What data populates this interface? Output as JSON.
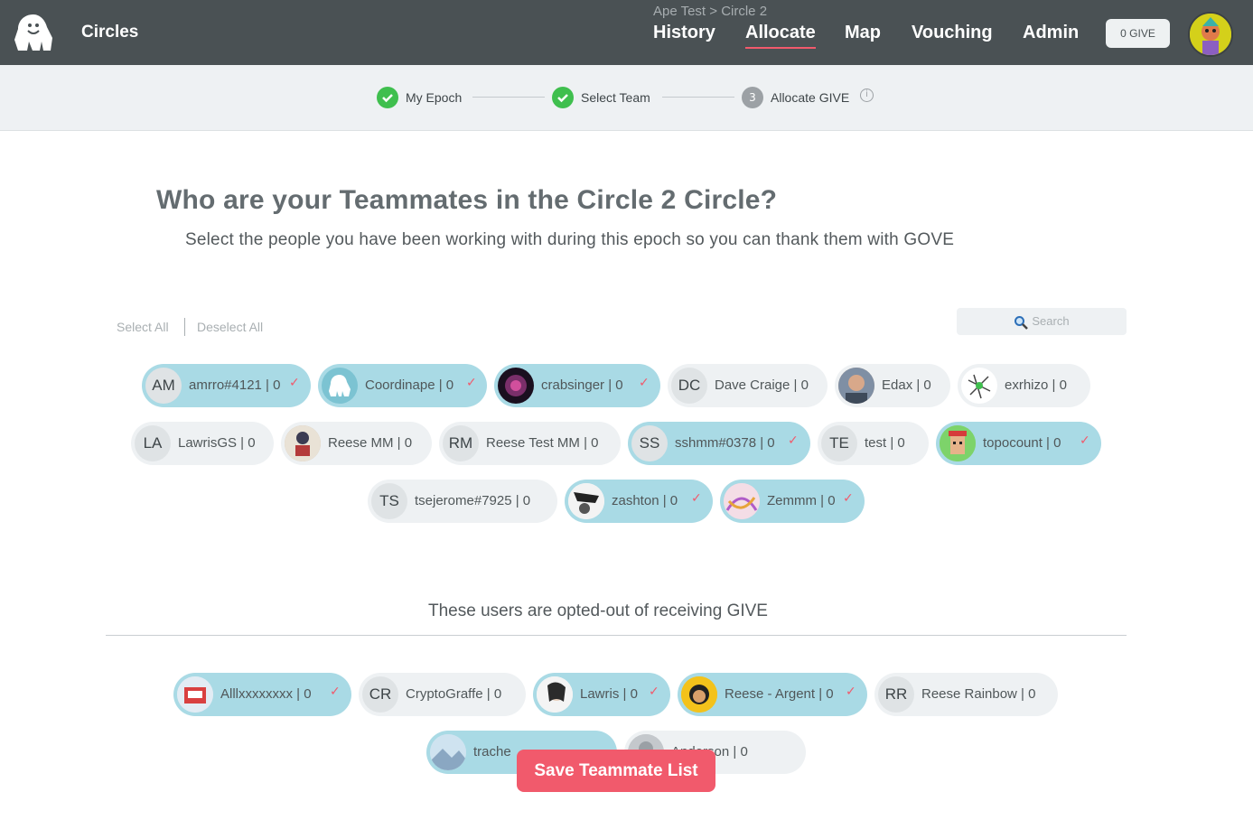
{
  "header": {
    "brand": "Circles",
    "breadcrumb": "Ape Test > Circle 2",
    "nav": [
      "History",
      "Allocate",
      "Map",
      "Vouching",
      "Admin"
    ],
    "active_nav": "Allocate",
    "give_button": "0 GIVE",
    "avatar_icon": "profile-avatar"
  },
  "steps": [
    {
      "label": "My Epoch",
      "state": "done"
    },
    {
      "label": "Select Team",
      "state": "done"
    },
    {
      "label": "Allocate GIVE",
      "state": "current",
      "number": "3"
    }
  ],
  "main": {
    "title": "Who are your Teammates in the Circle 2 Circle?",
    "subtitle": "Select the people you have been working with during this epoch so you can thank them with GOVE",
    "select_all": "Select All",
    "deselect_all": "Deselect All",
    "search_placeholder": "Search",
    "teammates": [
      {
        "initials": "AM",
        "label": "amrro#4121 | 0",
        "selected": true,
        "avatar": "initials"
      },
      {
        "initials": "",
        "label": "Coordinape | 0",
        "selected": true,
        "avatar": "gorilla-logo"
      },
      {
        "initials": "",
        "label": "crabsinger | 0",
        "selected": true,
        "avatar": "dark-art"
      },
      {
        "initials": "DC",
        "label": "Dave Craige | 0",
        "selected": false,
        "avatar": "initials"
      },
      {
        "initials": "",
        "label": "Edax | 0",
        "selected": false,
        "avatar": "photo"
      },
      {
        "initials": "",
        "label": "exrhizo | 0",
        "selected": false,
        "avatar": "sketch"
      },
      {
        "initials": "LA",
        "label": "LawrisGS | 0",
        "selected": false,
        "avatar": "initials"
      },
      {
        "initials": "",
        "label": "Reese MM | 0",
        "selected": false,
        "avatar": "poster"
      },
      {
        "initials": "RM",
        "label": "Reese Test MM | 0",
        "selected": false,
        "avatar": "initials"
      },
      {
        "initials": "SS",
        "label": "sshmm#0378 | 0",
        "selected": true,
        "avatar": "initials"
      },
      {
        "initials": "TE",
        "label": "test | 0",
        "selected": false,
        "avatar": "initials"
      },
      {
        "initials": "",
        "label": "topocount | 0",
        "selected": true,
        "avatar": "punk"
      },
      {
        "initials": "TS",
        "label": "tsejerome#7925 | 0",
        "selected": false,
        "avatar": "initials"
      },
      {
        "initials": "",
        "label": "zashton | 0",
        "selected": true,
        "avatar": "bw-art"
      },
      {
        "initials": "",
        "label": "Zemmm | 0",
        "selected": true,
        "avatar": "colorful-art"
      }
    ],
    "optout_heading": "These users are opted-out of receiving GIVE",
    "optout": [
      {
        "initials": "",
        "label": "Alllxxxxxxxx | 0",
        "selected": true,
        "avatar": "box-art"
      },
      {
        "initials": "CR",
        "label": "CryptoGraffe | 0",
        "selected": false,
        "avatar": "initials"
      },
      {
        "initials": "",
        "label": "Lawris | 0",
        "selected": true,
        "avatar": "sketch-face"
      },
      {
        "initials": "",
        "label": "Reese - Argent | 0",
        "selected": true,
        "avatar": "yellow-face"
      },
      {
        "initials": "RR",
        "label": "Reese Rainbow | 0",
        "selected": false,
        "avatar": "initials"
      },
      {
        "initials": "",
        "label": "trache",
        "selected": true,
        "avatar": "landscape"
      },
      {
        "initials": "",
        "label": "Anderson | 0",
        "selected": false,
        "avatar": "gray-photo"
      }
    ],
    "save_button": "Save Teammate List"
  },
  "colors": {
    "topbar": "#4a5154",
    "accent": "#f15a6c",
    "selected_chip": "#a9dae5",
    "chip": "#eef1f3",
    "step_done": "#3fbf4e"
  }
}
